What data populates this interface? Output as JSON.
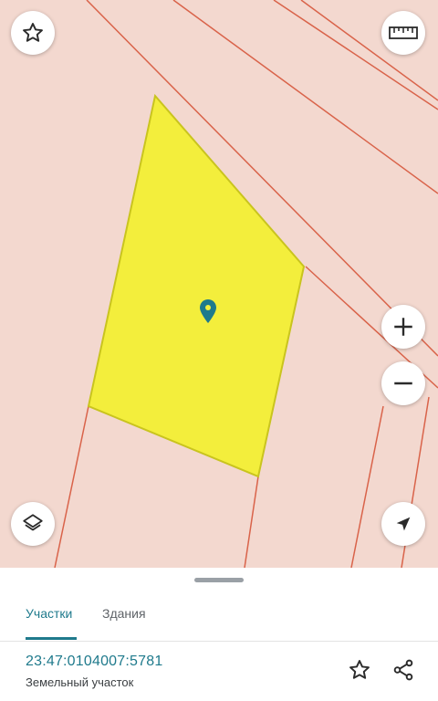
{
  "map": {
    "parcel_color": "#f3ee3c",
    "parcel_border": "#c9c41e",
    "background_color": "#f3d8cf",
    "boundary_color": "#d9634a",
    "marker_color": "#1f7a8c",
    "buttons": {
      "favorite_icon": "star-outline-icon",
      "ruler_icon": "ruler-icon",
      "zoom_in_icon": "plus-icon",
      "zoom_out_icon": "minus-icon",
      "layers_icon": "layers-icon",
      "locate_icon": "navigation-arrow-icon"
    }
  },
  "sheet": {
    "tabs": [
      {
        "label": "Участки",
        "active": true
      },
      {
        "label": "Здания",
        "active": false
      }
    ],
    "parcel": {
      "cadastral_number": "23:47:0104007:5781",
      "type": "Земельный участок"
    },
    "actions": {
      "favorite_icon": "star-outline-icon",
      "share_icon": "share-icon"
    },
    "accent_color": "#1f7a8c"
  }
}
